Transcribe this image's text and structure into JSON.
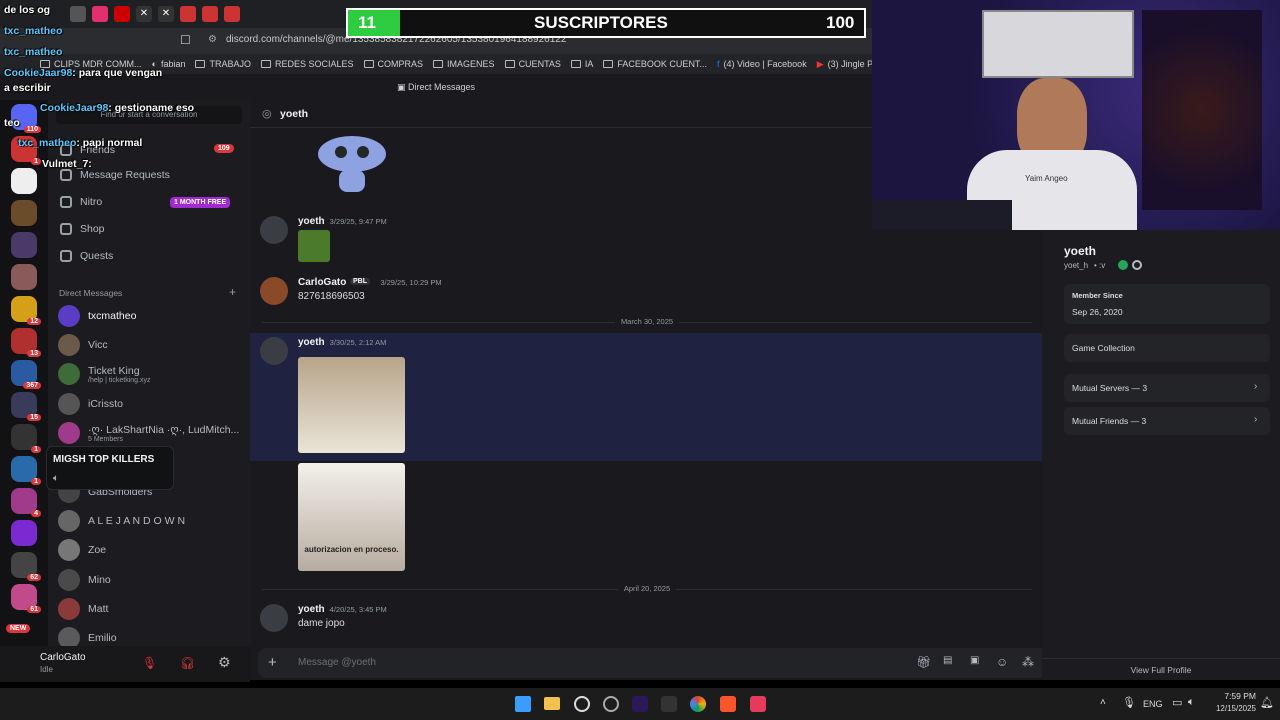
{
  "browser": {
    "url": "discord.com/channels/@me/1353858382172262605/1353801964188926122",
    "bookmarks": [
      "CLIPS MDR COMM...",
      "fabian",
      "TRABAJO",
      "REDES SOCIALES",
      "COMPRAS",
      "IMAGENES",
      "CUENTAS",
      "IA",
      "FACEBOOK CUENT...",
      "(4) Video | Facebook",
      "(3) Jingle Pun"
    ]
  },
  "discord": {
    "top_title": "Direct Messages",
    "search_placeholder": "Find or start a conversation",
    "nav": {
      "friends": "Friends",
      "friends_badge": "109",
      "message_requests": "Message Requests",
      "nitro": "Nitro",
      "nitro_badge": "1 MONTH FREE",
      "shop": "Shop",
      "quests": "Quests"
    },
    "dm_header": "Direct Messages",
    "dm_add": "+",
    "dms": [
      {
        "name": "txcmatheo",
        "sub": "",
        "color": "#5b3cc4"
      },
      {
        "name": "Vicc",
        "sub": "",
        "color": "#6b5a4a"
      },
      {
        "name": "Ticket King",
        "sub": "/help | ticketking.xyz",
        "color": "#3f6b3a"
      },
      {
        "name": "iCrissto",
        "sub": "",
        "color": "#555"
      },
      {
        "name": "·ღ· LakShartNia ·ღ·, LudMitch...",
        "sub": "5 Members",
        "color": "#a03a8a"
      },
      {
        "name": "GabSmolders",
        "sub": "",
        "color": "#444"
      },
      {
        "name": "A L E J A N D O W N",
        "sub": "",
        "color": "#666"
      },
      {
        "name": "Zoe",
        "sub": "",
        "color": "#777"
      },
      {
        "name": "Mino",
        "sub": "",
        "color": "#4a4a4a"
      },
      {
        "name": "Matt",
        "sub": "",
        "color": "#8a3a3a"
      },
      {
        "name": "Emilio",
        "sub": "",
        "color": "#5a5a5a"
      }
    ],
    "guild_badges": [
      "110",
      "1",
      "12",
      "13",
      "367",
      "15",
      "1",
      "1",
      "4",
      "62",
      "61"
    ],
    "guild_new": "NEW",
    "tooltip": "MIGSH TOP KILLERS",
    "user": {
      "name": "CarloGato",
      "status": "Idle"
    },
    "chat": {
      "recipient": "yoeth",
      "messages": [
        {
          "author": "yoeth",
          "time": "3/29/25, 9:47 PM",
          "text": ""
        },
        {
          "author": "CarloGato",
          "badge": "PBL",
          "time": "3/29/25, 10:29 PM",
          "text": "827618696503"
        },
        {
          "author": "yoeth",
          "time": "3/30/25, 2:12 AM",
          "text": ""
        },
        {
          "author": "yoeth",
          "time": "4/20/25, 3:45 PM",
          "text": "dame jopo"
        }
      ],
      "dividers": [
        "March 30, 2025",
        "April 20, 2025"
      ],
      "image_caption": "autorizacion en proceso.",
      "input_placeholder": "Message @yoeth"
    },
    "profile": {
      "display_name": "yoeth",
      "username": "yoet_h",
      "username_suffix": "• :v",
      "member_since_label": "Member Since",
      "member_since": "Sep 26, 2020",
      "game_collection": "Game Collection",
      "mutual_servers": "Mutual Servers — 3",
      "mutual_friends": "Mutual Friends — 3",
      "view_full": "View Full Profile"
    }
  },
  "stream_overlay": {
    "goal_current": "11",
    "goal_label": "SUSCRIPTORES",
    "goal_target": "100",
    "chat": [
      {
        "name": "",
        "text": "de los og"
      },
      {
        "name": "txc_matheo",
        "text": ""
      },
      {
        "name": "txc_matheo",
        "text": ""
      },
      {
        "name": "CookieJaar98",
        "text": ": para que vengan"
      },
      {
        "name": "",
        "text": "a escribir"
      },
      {
        "name": "CookieJaar98",
        "text": ": gestioname eso"
      },
      {
        "name": "",
        "text": "teo"
      },
      {
        "name": "txc_matheo",
        "text": ": papi normal"
      },
      {
        "name": "Vulmet_7",
        "text": ":"
      }
    ],
    "cam_text": "Yaim Angeo"
  },
  "taskbar": {
    "lang": "ENG",
    "time": "7:59 PM",
    "date": "12/15/2025"
  },
  "colors": {
    "accent": "#5865f2",
    "nitro": "#a12bd1",
    "online": "#23a55a",
    "red": "#da373c",
    "subs_green": "#2ecc40"
  }
}
